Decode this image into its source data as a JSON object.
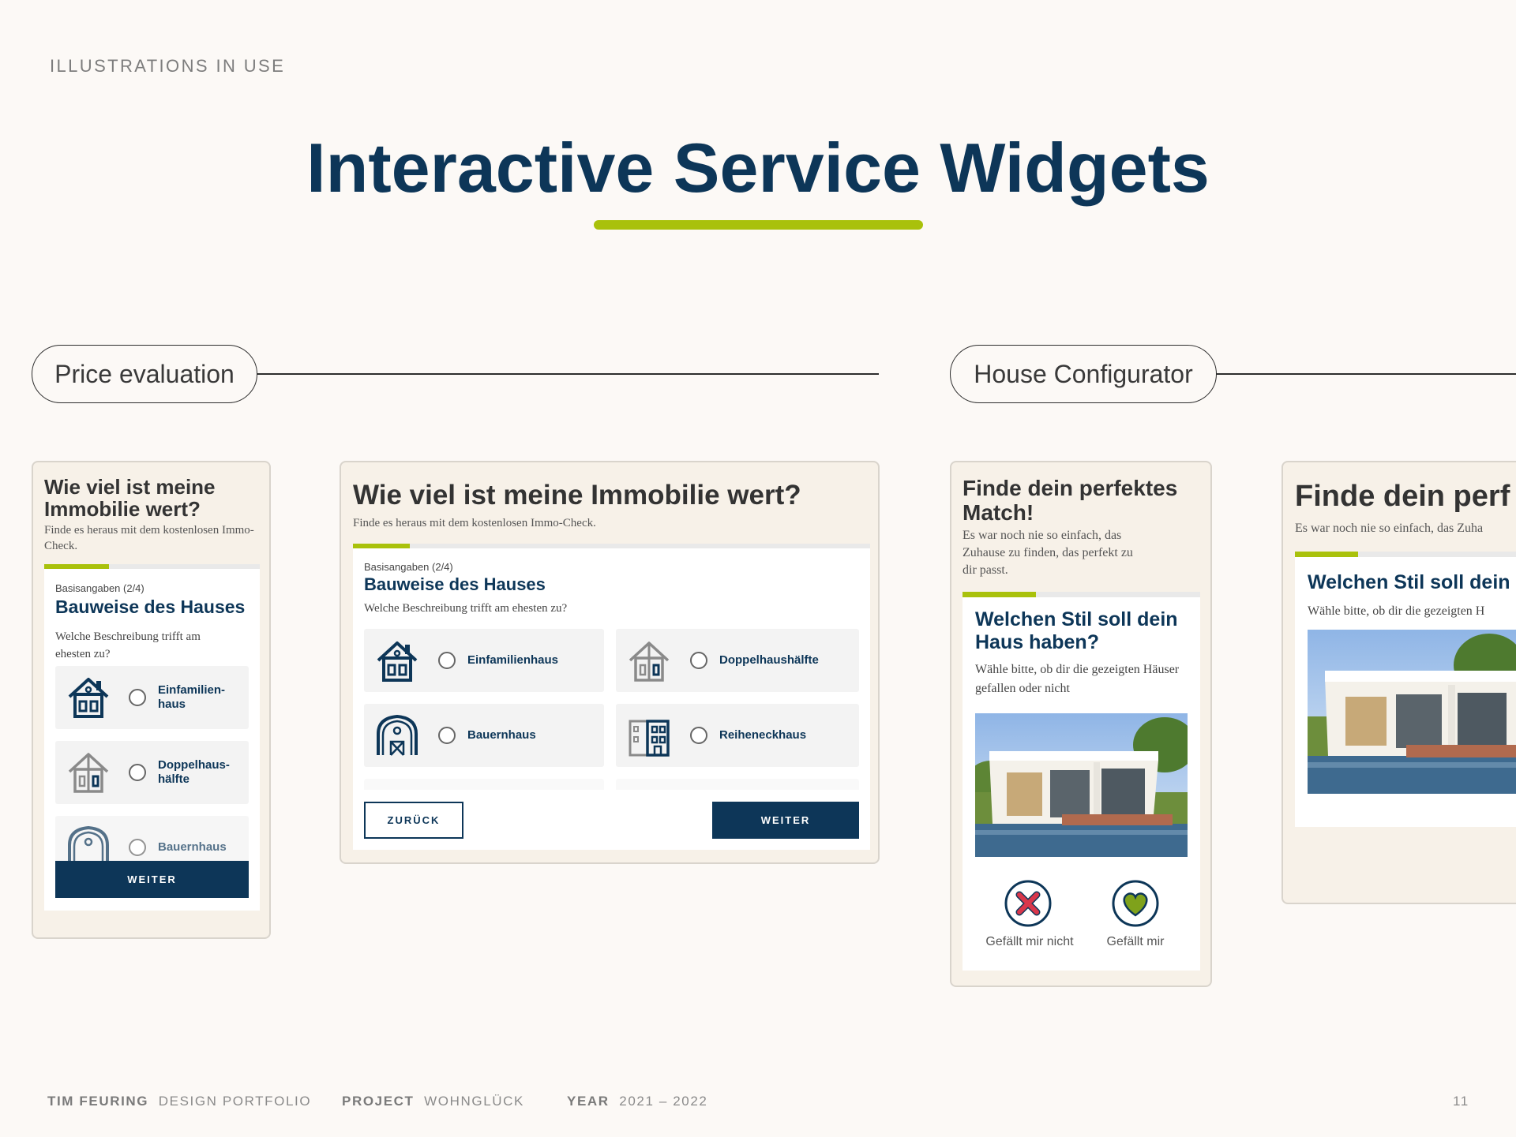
{
  "header": {
    "eyebrow": "ILLUSTRATIONS IN USE",
    "title": "Interactive Service Widgets"
  },
  "sections": {
    "price": "Price evaluation",
    "house": "House Configurator"
  },
  "widget_small": {
    "heading": "Wie viel ist meine Immobilie wert?",
    "subtitle": "Finde es heraus mit dem kostenlosen Immo-Check.",
    "progress": 0.3,
    "step": "Basisangaben (2/4)",
    "question": "Bauweise des Hauses",
    "description": "Welche Beschreibung trifft am ehesten zu?",
    "options": [
      "Einfamilien-haus",
      "Doppelhaus-hälfte",
      "Bauernhaus"
    ],
    "next_label": "WEITER"
  },
  "widget_wide": {
    "heading": "Wie viel ist meine Immobilie wert?",
    "subtitle": "Finde es heraus mit dem kostenlosen Immo-Check.",
    "progress": 0.11,
    "step": "Basisangaben (2/4)",
    "question": "Bauweise des Hauses",
    "description": "Welche Beschreibung trifft am ehesten zu?",
    "options": [
      "Einfamilienhaus",
      "Doppelhaushälfte",
      "Bauernhaus",
      "Reiheneckhaus"
    ],
    "back_label": "ZURÜCK",
    "next_label": "WEITER"
  },
  "config_small": {
    "heading": "Finde dein perfektes Match!",
    "subtitle": "Es war noch nie so einfach, das Zuhause zu finden, das perfekt zu dir passt.",
    "progress": 0.31,
    "question": "Welchen Stil soll dein Haus haben?",
    "description": "Wähle bitte, ob dir die gezeigten Häuser gefallen oder nicht",
    "dislike_label": "Gefällt mir nicht",
    "like_label": "Gefällt mir"
  },
  "config_wide": {
    "heading": "Finde dein perf",
    "subtitle": "Es war noch nie so einfach, das Zuha",
    "question": "Welchen Stil soll dein",
    "description": "Wähle bitte, ob dir die gezeigten H"
  },
  "footer": {
    "author_label": "TIM FEURING",
    "author_value": "DESIGN PORTFOLIO",
    "project_label": "PROJECT",
    "project_value": "WOHNGLÜCK",
    "year_label": "YEAR",
    "year_value": "2021 – 2022",
    "page_number": "11"
  },
  "colors": {
    "navy": "#0d3658",
    "accent_green": "#a9c10b",
    "background": "#fcf9f6",
    "card_beige": "#f7f1e8",
    "dislike_red": "#d9374b",
    "like_green": "#7fa21b"
  },
  "icons": [
    "house-icon",
    "semi-detached-house-icon",
    "barn-icon",
    "townhouse-icon",
    "dislike-x-icon",
    "like-heart-icon"
  ]
}
